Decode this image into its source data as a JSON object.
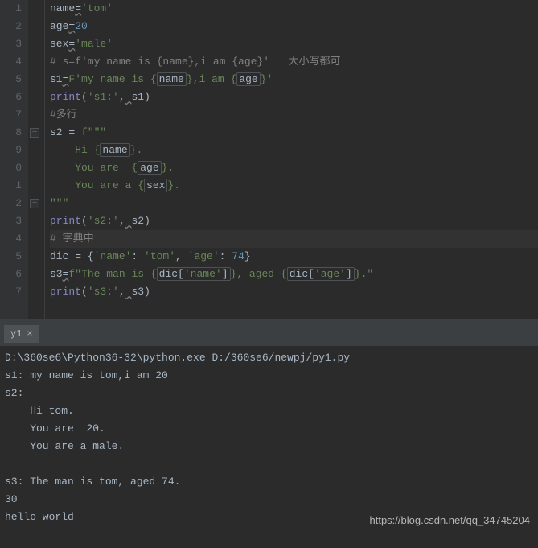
{
  "gutter": [
    "1",
    "2",
    "3",
    "4",
    "5",
    "6",
    "7",
    "8",
    "9",
    "0",
    "1",
    "2",
    "3",
    "4",
    "5",
    "6",
    "7"
  ],
  "code": {
    "l1": {
      "k1": "name",
      "op": "=",
      "v": "'tom'"
    },
    "l2": {
      "k1": "age",
      "op": "=",
      "v": "20"
    },
    "l3": {
      "k1": "sex",
      "op": "=",
      "v": "'male'"
    },
    "l4": {
      "c": "# s=f'my name is {name},i am {age}'   大小写都可"
    },
    "l5": {
      "a": "s1",
      "op": "=",
      "pre": "F",
      "s1": "'my name is {",
      "box": "name",
      "s2": "},i am {",
      "box2": "age",
      "s3": "}'"
    },
    "l6": {
      "fn": "print",
      "p1": "(",
      "s": "'s1:'",
      "c": ",",
      "sp": " ",
      "v": "s1",
      "p2": ")"
    },
    "l7": {
      "c": "#多行"
    },
    "l8": {
      "a": "s2 = ",
      "pre": "f",
      "s": "\"\"\""
    },
    "l9": {
      "s1": "    Hi {",
      "box": "name",
      "s2": "}."
    },
    "l10": {
      "s1": "    You are  {",
      "box": "age",
      "s2": "}."
    },
    "l11": {
      "s1": "    You are a {",
      "box": "sex",
      "s2": "}."
    },
    "l12": {
      "s": "\"\"\""
    },
    "l13": {
      "fn": "print",
      "p1": "(",
      "s": "'s2:'",
      "c": ",",
      "sp": " ",
      "v": "s2",
      "p2": ")"
    },
    "l14": {
      "c": "# 字典中"
    },
    "l15": {
      "a": "dic = {",
      "k1": "'name'",
      "c1": ": ",
      "v1": "'tom'",
      "c2": ", ",
      "k2": "'age'",
      "c3": ": ",
      "v2": "74",
      "e": "}"
    },
    "l16": {
      "a": "s3",
      "op": "=",
      "pre": "f",
      "s1": "\"The man is {",
      "d": "dic[",
      "k": "'name'",
      "db": "]",
      "s2": "}, aged {",
      "d2": "dic[",
      "k2": "'age'",
      "db2": "]",
      "s3": "}.\""
    },
    "l17": {
      "fn": "print",
      "p1": "(",
      "s": "'s3:'",
      "c": ",",
      "sp": " ",
      "v": "s3",
      "p2": ")"
    }
  },
  "tab": {
    "label": "y1",
    "close": "×"
  },
  "console": {
    "lines": [
      "D:\\360se6\\Python36-32\\python.exe D:/360se6/newpj/py1.py",
      "s1: my name is tom,i am 20",
      "s2:",
      "    Hi tom.",
      "    You are  20.",
      "    You are a male.",
      "",
      "s3: The man is tom, aged 74.",
      "30",
      "hello world"
    ]
  },
  "watermark": "https://blog.csdn.net/qq_34745204"
}
